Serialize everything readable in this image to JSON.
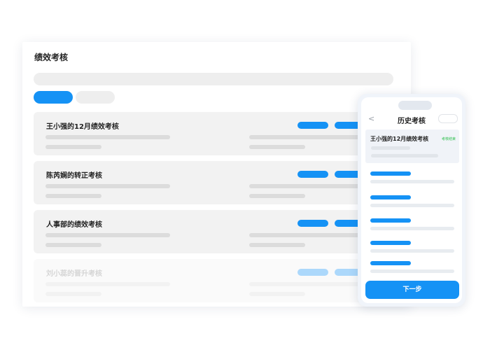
{
  "desktop": {
    "title": "绩效考核",
    "tabs": [
      {
        "active": true
      },
      {
        "active": false
      }
    ],
    "rows": [
      {
        "title": "王小强的12月绩效考核"
      },
      {
        "title": "陈芮娴的转正考核"
      },
      {
        "title": "人事部的绩效考核"
      },
      {
        "title": "刘小蕊的晋升考核"
      }
    ]
  },
  "phone": {
    "back_icon": "<",
    "title": "历史考核",
    "card": {
      "title": "王小强的12月绩效考核",
      "badge": "考核结束"
    },
    "list_count": 5,
    "next_button": "下一步"
  },
  "colors": {
    "primary": "#1592f5",
    "success": "#2bbf4b",
    "row_bg": "#f2f2f2",
    "skeleton": "#dcdcdc"
  }
}
